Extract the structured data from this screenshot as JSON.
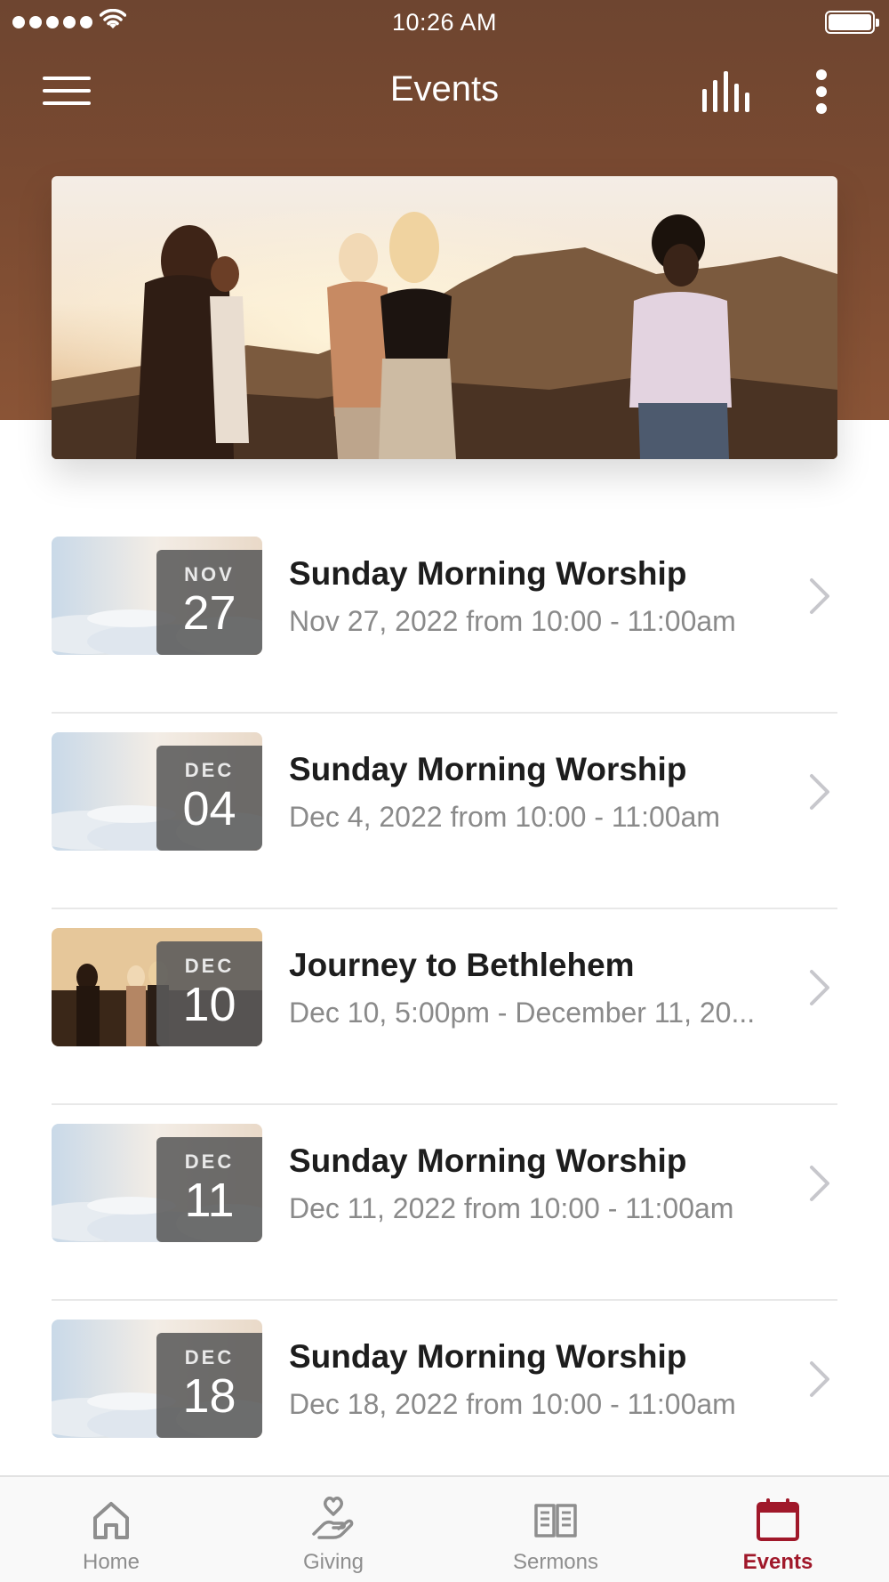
{
  "status_bar": {
    "time": "10:26 AM"
  },
  "nav": {
    "title": "Events"
  },
  "events": [
    {
      "month": "NOV",
      "day": "27",
      "title": "Sunday Morning Worship",
      "subtitle": "Nov 27, 2022 from 10:00 - 11:00am"
    },
    {
      "month": "DEC",
      "day": "04",
      "title": "Sunday Morning Worship",
      "subtitle": "Dec 4, 2022 from 10:00 - 11:00am"
    },
    {
      "month": "DEC",
      "day": "10",
      "title": "Journey to Bethlehem",
      "subtitle": "Dec 10, 5:00pm - December 11, 20..."
    },
    {
      "month": "DEC",
      "day": "11",
      "title": "Sunday Morning Worship",
      "subtitle": "Dec 11, 2022 from 10:00 - 11:00am"
    },
    {
      "month": "DEC",
      "day": "18",
      "title": "Sunday Morning Worship",
      "subtitle": "Dec 18, 2022 from 10:00 - 11:00am"
    }
  ],
  "tabs": [
    {
      "label": "Home",
      "icon": "home-icon"
    },
    {
      "label": "Giving",
      "icon": "giving-hand-heart-icon"
    },
    {
      "label": "Sermons",
      "icon": "open-book-icon"
    },
    {
      "label": "Events",
      "icon": "calendar-icon",
      "active": true
    }
  ],
  "colors": {
    "header": "#7a4a31",
    "accent": "#a0182a",
    "tab_inactive": "#8e8e8e"
  }
}
